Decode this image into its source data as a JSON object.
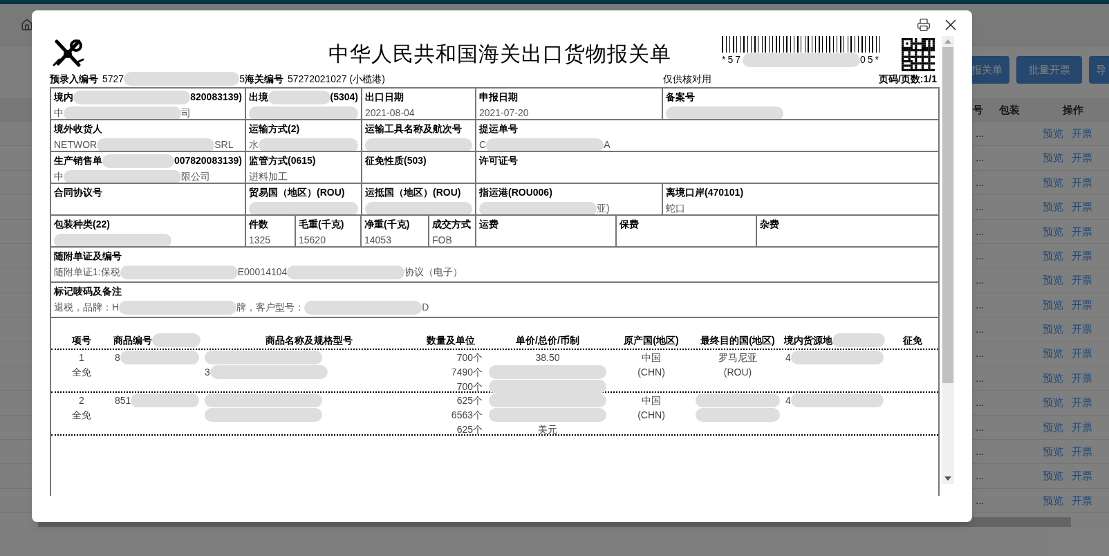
{
  "background": {
    "buttons": [
      "报关单",
      "批量开票",
      "导"
    ],
    "columns": [
      "号",
      "包装",
      "操作"
    ],
    "rows": [
      {
        "cell": "...",
        "actions": [
          "预览",
          "开票"
        ]
      },
      {
        "cell": "...",
        "actions": [
          "预览",
          "开票"
        ]
      },
      {
        "cell": "...",
        "actions": [
          "预览",
          "开票"
        ]
      },
      {
        "cell": "...",
        "actions": [
          "预览",
          "开票"
        ]
      },
      {
        "cell": "...",
        "actions": [
          "预览",
          "开票"
        ]
      },
      {
        "cell": "...",
        "actions": [
          "预览",
          "开票"
        ]
      },
      {
        "cell": "...",
        "actions": [
          "预览",
          "开票"
        ]
      },
      {
        "cell": "...",
        "actions": [
          "预览",
          "开票"
        ]
      },
      {
        "cell": "...",
        "actions": [
          "预览",
          "开票"
        ]
      },
      {
        "cell": "...",
        "actions": [
          "预览",
          "开票"
        ]
      },
      {
        "cell": "...",
        "actions": [
          "预览",
          "开票"
        ]
      },
      {
        "cell": "...",
        "actions": [
          "预览",
          "开票"
        ]
      },
      {
        "cell": "...",
        "actions": [
          "预览",
          "开票"
        ]
      },
      {
        "cell": "...",
        "actions": [
          "预览",
          "开票"
        ]
      },
      {
        "cell": "...",
        "actions": [
          "预览",
          "开票"
        ]
      },
      {
        "cell": "...",
        "actions": [
          "预览",
          "开票"
        ]
      }
    ]
  },
  "dialog": {
    "title": "中华人民共和国海关出口货物报关单",
    "barcode_caption": [
      "*57",
      {
        "kind": "redacted"
      },
      "05*"
    ],
    "info": [
      {
        "label": "预录入编号",
        "value": [
          "5727",
          {
            "kind": "redacted"
          },
          "5"
        ]
      },
      {
        "label": "海关编号",
        "value": [
          "57272021027 (小榄港)"
        ]
      }
    ],
    "note": "仅供核对用",
    "page": "页码/页数:1/1",
    "form_rows": [
      {
        "cells": [
          {
            "label": [
              "境内",
              {
                "kind": "redacted"
              },
              "820083139)"
            ],
            "value": [
              "中",
              {
                "kind": "redacted"
              },
              "司"
            ]
          },
          {
            "label": [
              "出境",
              {
                "kind": "redacted"
              },
              "(5304)"
            ],
            "value": [
              {
                "kind": "redacted"
              }
            ]
          },
          {
            "label": [
              "出口日期"
            ],
            "value": [
              "2021-08-04"
            ]
          },
          {
            "label": [
              "申报日期"
            ],
            "value": [
              "2021-07-20"
            ]
          },
          {
            "label": [
              "备案号"
            ],
            "value": [
              {
                "kind": "redacted"
              }
            ]
          }
        ]
      },
      {
        "cells": [
          {
            "label": [
              "境外收货人"
            ],
            "value": [
              "NETWOR",
              {
                "kind": "redacted"
              },
              "SRL"
            ]
          },
          {
            "label": [
              "运输方式(2)"
            ],
            "value": [
              "水",
              {
                "kind": "redacted"
              }
            ]
          },
          {
            "label": [
              "运输工具名称及航次号"
            ],
            "value": [
              {
                "kind": "redacted"
              }
            ]
          },
          {
            "label": [
              "提运单号"
            ],
            "value": [
              "C",
              {
                "kind": "redacted"
              },
              "A"
            ]
          }
        ]
      },
      {
        "cells": [
          {
            "label": [
              "生产销售单",
              {
                "kind": "redacted"
              },
              "007820083139)"
            ],
            "value": [
              "中",
              {
                "kind": "redacted"
              },
              "限公司"
            ]
          },
          {
            "label": [
              "监管方式(0615)"
            ],
            "value": [
              "进料加工"
            ]
          },
          {
            "label": [
              "征免性质(503)"
            ]
          },
          {
            "label": [
              "许可证号"
            ]
          }
        ]
      },
      {
        "cells": [
          {
            "label": [
              "合同协议号"
            ]
          },
          {
            "label": [
              "贸易国（地区）(ROU)"
            ],
            "value": [
              {
                "kind": "redacted"
              }
            ]
          },
          {
            "label": [
              "运抵国（地区）(ROU)"
            ],
            "value": [
              {
                "kind": "redacted"
              }
            ]
          },
          {
            "label": [
              "指运港(ROU006)"
            ],
            "value": [
              {
                "kind": "redacted"
              },
              "亚)"
            ]
          },
          {
            "label": [
              "离境口岸(470101)"
            ],
            "value": [
              "蛇口"
            ]
          }
        ]
      },
      {
        "cells": [
          {
            "label": [
              "包装种类(22)"
            ],
            "value": [
              {
                "kind": "redacted"
              }
            ]
          },
          {
            "label": [
              "件数"
            ],
            "value": [
              "1325"
            ]
          },
          {
            "label": [
              "毛重(千克)"
            ],
            "value": [
              "15620"
            ]
          },
          {
            "label": [
              "净重(千克)"
            ],
            "value": [
              "14053"
            ]
          },
          {
            "label": [
              "成交方式"
            ],
            "value": [
              "FOB"
            ]
          },
          {
            "label": [
              "运费"
            ]
          },
          {
            "label": [
              "保费"
            ]
          },
          {
            "label": [
              "杂费"
            ]
          }
        ]
      },
      {
        "cells": [
          {
            "label": [
              "随附单证及编号"
            ],
            "value": [
              "随附单证1:保税",
              {
                "kind": "redacted"
              },
              "E00014104",
              {
                "kind": "redacted"
              },
              "协议（电子）"
            ]
          }
        ]
      },
      {
        "cells": [
          {
            "label": [
              "标记唛码及备注"
            ],
            "value": [
              "退税，品牌：H",
              {
                "kind": "redacted"
              },
              "牌，客户型号：",
              {
                "kind": "redacted"
              },
              "D"
            ]
          }
        ]
      }
    ],
    "goods": {
      "columns": [
        {
          "label": [
            "项号"
          ]
        },
        {
          "label": [
            "商品编号",
            {
              "kind": "redacted"
            }
          ]
        },
        {
          "label": [
            "商品名称及规格型号"
          ]
        },
        {
          "label": [
            "数量及单位"
          ]
        },
        {
          "label": [
            "单价/总价/币制"
          ]
        },
        {
          "label": [
            "原产国(地区)"
          ]
        },
        {
          "label": [
            "最终目的国(地区)"
          ]
        },
        {
          "label": [
            "境内货源地",
            {
              "kind": "redacted"
            }
          ]
        },
        {
          "label": [
            "征免"
          ]
        }
      ],
      "rows": [
        {
          "cells": [
            {
              "lines": [
                [
                  "1"
                ],
                [
                  "全免"
                ]
              ]
            },
            {
              "lines": [
                [
                  "8",
                  {
                    "kind": "redacted"
                  }
                ]
              ]
            },
            {
              "lines": [
                [
                  {
                    "kind": "redacted"
                  }
                ],
                [
                  "3",
                  {
                    "kind": "redacted"
                  }
                ]
              ]
            },
            {
              "lines": [
                [
                  "700个"
                ],
                [
                  "7490个"
                ],
                [
                  "700个"
                ]
              ]
            },
            {
              "lines": [
                [
                  "38.50"
                ],
                [
                  {
                    "kind": "redacted"
                  }
                ],
                [
                  {
                    "kind": "redacted"
                  }
                ]
              ]
            },
            {
              "lines": [
                [
                  "中国"
                ],
                [
                  "(CHN)"
                ]
              ]
            },
            {
              "lines": [
                [
                  "罗马尼亚"
                ],
                [
                  "(ROU)"
                ]
              ]
            },
            {
              "lines": [
                [
                  "4",
                  {
                    "kind": "redacted"
                  }
                ]
              ]
            },
            null
          ]
        },
        {
          "cells": [
            {
              "lines": [
                [
                  "2"
                ],
                [
                  "全免"
                ]
              ]
            },
            {
              "lines": [
                [
                  "851",
                  {
                    "kind": "redacted"
                  }
                ]
              ]
            },
            {
              "lines": [
                [
                  {
                    "kind": "redacted"
                  }
                ],
                [
                  {
                    "kind": "redacted"
                  }
                ]
              ]
            },
            {
              "lines": [
                [
                  "625个"
                ],
                [
                  "6563个"
                ],
                [
                  "625个"
                ]
              ]
            },
            {
              "lines": [
                [
                  {
                    "kind": "redacted"
                  }
                ],
                [
                  {
                    "kind": "redacted"
                  }
                ],
                [
                  "美元"
                ]
              ]
            },
            {
              "lines": [
                [
                  "中国"
                ],
                [
                  "(CHN)"
                ]
              ]
            },
            {
              "lines": [
                [
                  {
                    "kind": "redacted"
                  }
                ],
                [
                  {
                    "kind": "redacted"
                  }
                ]
              ]
            },
            {
              "lines": [
                [
                  "4",
                  {
                    "kind": "redacted"
                  }
                ]
              ]
            },
            null
          ]
        }
      ]
    }
  }
}
